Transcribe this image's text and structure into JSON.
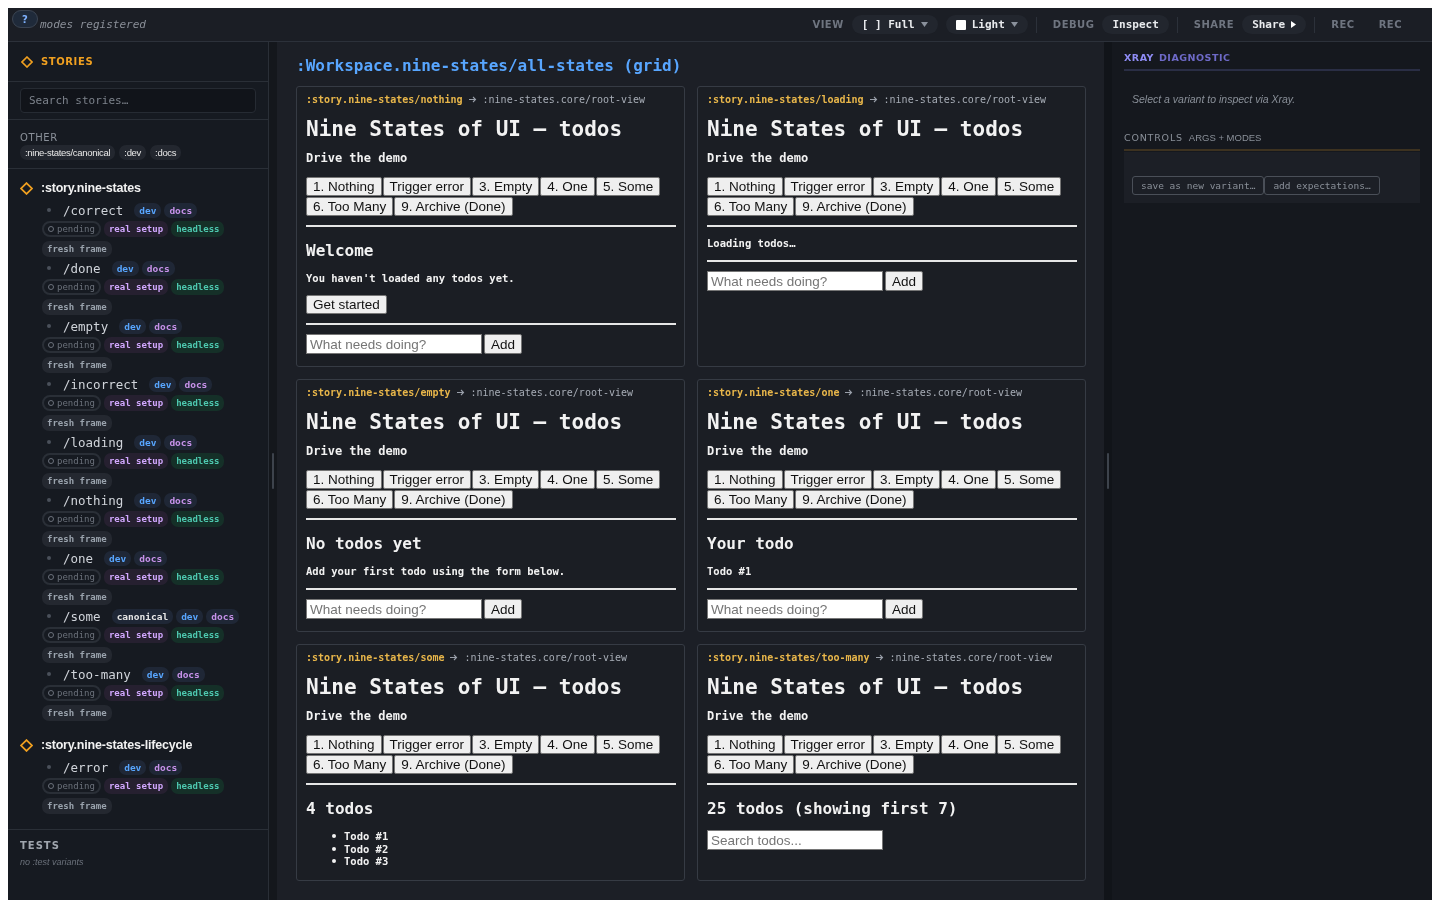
{
  "topbar": {
    "help": "?",
    "modes_text": "modes registered",
    "toolbar": [
      {
        "kind": "label",
        "text": "VIEW"
      },
      {
        "kind": "dropdown",
        "text": "[ ] Full"
      },
      {
        "kind": "swatch-dropdown",
        "text": "Light"
      },
      {
        "kind": "divider"
      },
      {
        "kind": "label",
        "text": "DEBUG"
      },
      {
        "kind": "button",
        "text": "Inspect"
      },
      {
        "kind": "divider"
      },
      {
        "kind": "label",
        "text": "SHARE"
      },
      {
        "kind": "menu",
        "text": "Share"
      },
      {
        "kind": "divider"
      },
      {
        "kind": "plain",
        "text": "REC"
      },
      {
        "kind": "plain",
        "text": "REC"
      }
    ]
  },
  "sidebar": {
    "title": "STORIES",
    "search_placeholder": "Search stories…",
    "other": {
      "title": "OTHER",
      "chips": [
        ":nine-states/canonical",
        ":dev",
        ":docs"
      ]
    },
    "groups": [
      {
        "name": ":story.nine-states",
        "variants": [
          {
            "name": "/correct",
            "tags": [
              {
                "label": "dev",
                "color": "#58a6ff"
              },
              {
                "label": "docs",
                "color": "#c792ea"
              }
            ],
            "status": "pending",
            "badges": [
              {
                "label": "real setup",
                "color": "#d2a8ff"
              },
              {
                "label": "headless",
                "color": "#4ec9b0"
              },
              {
                "label": "fresh frame",
                "color": "#9aa3ad"
              }
            ]
          },
          {
            "name": "/done",
            "tags": [
              {
                "label": "dev",
                "color": "#58a6ff"
              },
              {
                "label": "docs",
                "color": "#c792ea"
              }
            ],
            "status": "pending",
            "badges": [
              {
                "label": "real setup",
                "color": "#d2a8ff"
              },
              {
                "label": "headless",
                "color": "#4ec9b0"
              },
              {
                "label": "fresh frame",
                "color": "#9aa3ad"
              }
            ]
          },
          {
            "name": "/empty",
            "tags": [
              {
                "label": "dev",
                "color": "#58a6ff"
              },
              {
                "label": "docs",
                "color": "#c792ea"
              }
            ],
            "status": "pending",
            "badges": [
              {
                "label": "real setup",
                "color": "#d2a8ff"
              },
              {
                "label": "headless",
                "color": "#4ec9b0"
              },
              {
                "label": "fresh frame",
                "color": "#9aa3ad"
              }
            ]
          },
          {
            "name": "/incorrect",
            "tags": [
              {
                "label": "dev",
                "color": "#58a6ff"
              },
              {
                "label": "docs",
                "color": "#c792ea"
              }
            ],
            "status": "pending",
            "badges": [
              {
                "label": "real setup",
                "color": "#d2a8ff"
              },
              {
                "label": "headless",
                "color": "#4ec9b0"
              },
              {
                "label": "fresh frame",
                "color": "#9aa3ad"
              }
            ]
          },
          {
            "name": "/loading",
            "tags": [
              {
                "label": "dev",
                "color": "#58a6ff"
              },
              {
                "label": "docs",
                "color": "#c792ea"
              }
            ],
            "status": "pending",
            "badges": [
              {
                "label": "real setup",
                "color": "#d2a8ff"
              },
              {
                "label": "headless",
                "color": "#4ec9b0"
              },
              {
                "label": "fresh frame",
                "color": "#9aa3ad"
              }
            ]
          },
          {
            "name": "/nothing",
            "tags": [
              {
                "label": "dev",
                "color": "#58a6ff"
              },
              {
                "label": "docs",
                "color": "#c792ea"
              }
            ],
            "status": "pending",
            "badges": [
              {
                "label": "real setup",
                "color": "#d2a8ff"
              },
              {
                "label": "headless",
                "color": "#4ec9b0"
              },
              {
                "label": "fresh frame",
                "color": "#9aa3ad"
              }
            ]
          },
          {
            "name": "/one",
            "tags": [
              {
                "label": "dev",
                "color": "#58a6ff"
              },
              {
                "label": "docs",
                "color": "#c792ea"
              }
            ],
            "status": "pending",
            "badges": [
              {
                "label": "real setup",
                "color": "#d2a8ff"
              },
              {
                "label": "headless",
                "color": "#4ec9b0"
              },
              {
                "label": "fresh frame",
                "color": "#9aa3ad"
              }
            ]
          },
          {
            "name": "/some",
            "tags": [
              {
                "label": "canonical",
                "color": "#e6e6e6"
              },
              {
                "label": "dev",
                "color": "#58a6ff"
              },
              {
                "label": "docs",
                "color": "#c792ea"
              }
            ],
            "status": "pending",
            "badges": [
              {
                "label": "real setup",
                "color": "#d2a8ff"
              },
              {
                "label": "headless",
                "color": "#4ec9b0"
              },
              {
                "label": "fresh frame",
                "color": "#9aa3ad"
              }
            ]
          },
          {
            "name": "/too-many",
            "tags": [
              {
                "label": "dev",
                "color": "#58a6ff"
              },
              {
                "label": "docs",
                "color": "#c792ea"
              }
            ],
            "status": "pending",
            "badges": [
              {
                "label": "real setup",
                "color": "#d2a8ff"
              },
              {
                "label": "headless",
                "color": "#4ec9b0"
              },
              {
                "label": "fresh frame",
                "color": "#9aa3ad"
              }
            ]
          }
        ]
      },
      {
        "name": ":story.nine-states-lifecycle",
        "variants": [
          {
            "name": "/error",
            "tags": [
              {
                "label": "dev",
                "color": "#58a6ff"
              },
              {
                "label": "docs",
                "color": "#c792ea"
              }
            ],
            "status": "pending",
            "badges": [
              {
                "label": "real setup",
                "color": "#d2a8ff"
              },
              {
                "label": "headless",
                "color": "#4ec9b0"
              },
              {
                "label": "fresh frame",
                "color": "#9aa3ad"
              }
            ]
          }
        ]
      }
    ],
    "tests": {
      "title": "TESTS",
      "empty_text": "no :test variants"
    }
  },
  "workspace": {
    "title": ":Workspace.nine-states/all-states (grid)",
    "cards": [
      {
        "story": ":story.nine-states/nothing",
        "target": ":nine-states.core/root-view",
        "title": "Nine States of UI — todos",
        "subtitle": "Drive the demo",
        "buttons": [
          "1. Nothing",
          "Trigger error",
          "3. Empty",
          "4. One",
          "5. Some",
          "6. Too Many",
          "9. Archive (Done)"
        ],
        "body": {
          "kind": "welcome",
          "heading": "Welcome",
          "text": "You haven't loaded any todos yet.",
          "button": "Get started"
        },
        "form": {
          "placeholder": "What needs doing?",
          "button": "Add"
        }
      },
      {
        "story": ":story.nine-states/loading",
        "target": ":nine-states.core/root-view",
        "title": "Nine States of UI — todos",
        "subtitle": "Drive the demo",
        "buttons": [
          "1. Nothing",
          "Trigger error",
          "3. Empty",
          "4. One",
          "5. Some",
          "6. Too Many",
          "9. Archive (Done)"
        ],
        "body": {
          "kind": "message",
          "text": "Loading todos…"
        },
        "form": {
          "placeholder": "What needs doing?",
          "button": "Add"
        }
      },
      {
        "story": ":story.nine-states/empty",
        "target": ":nine-states.core/root-view",
        "title": "Nine States of UI — todos",
        "subtitle": "Drive the demo",
        "buttons": [
          "1. Nothing",
          "Trigger error",
          "3. Empty",
          "4. One",
          "5. Some",
          "6. Too Many",
          "9. Archive (Done)"
        ],
        "body": {
          "kind": "info",
          "heading": "No todos yet",
          "text": "Add your first todo using the form below."
        },
        "form": {
          "placeholder": "What needs doing?",
          "button": "Add"
        }
      },
      {
        "story": ":story.nine-states/one",
        "target": ":nine-states.core/root-view",
        "title": "Nine States of UI — todos",
        "subtitle": "Drive the demo",
        "buttons": [
          "1. Nothing",
          "Trigger error",
          "3. Empty",
          "4. One",
          "5. Some",
          "6. Too Many",
          "9. Archive (Done)"
        ],
        "body": {
          "kind": "info",
          "heading": "Your todo",
          "text": "Todo #1"
        },
        "form": {
          "placeholder": "What needs doing?",
          "button": "Add"
        }
      },
      {
        "story": ":story.nine-states/some",
        "target": ":nine-states.core/root-view",
        "title": "Nine States of UI — todos",
        "subtitle": "Drive the demo",
        "buttons": [
          "1. Nothing",
          "Trigger error",
          "3. Empty",
          "4. One",
          "5. Some",
          "6. Too Many",
          "9. Archive (Done)"
        ],
        "body": {
          "kind": "list",
          "heading": "4 todos",
          "items": [
            "Todo #1",
            "Todo #2",
            "Todo #3"
          ]
        }
      },
      {
        "story": ":story.nine-states/too-many",
        "target": ":nine-states.core/root-view",
        "title": "Nine States of UI — todos",
        "subtitle": "Drive the demo",
        "buttons": [
          "1. Nothing",
          "Trigger error",
          "3. Empty",
          "4. One",
          "5. Some",
          "6. Too Many",
          "9. Archive (Done)"
        ],
        "body": {
          "kind": "search",
          "heading": "25 todos (showing first 7)",
          "placeholder": "Search todos..."
        }
      }
    ]
  },
  "xray": {
    "title": "XRAY",
    "subtitle": "DIAGNOSTIC",
    "hint": "Select a variant to inspect via Xray.",
    "controls_title": "CONTROLS",
    "controls_subtitle": "ARGS + MODES",
    "buttons": [
      "save as new variant…",
      "add expectations…"
    ]
  }
}
